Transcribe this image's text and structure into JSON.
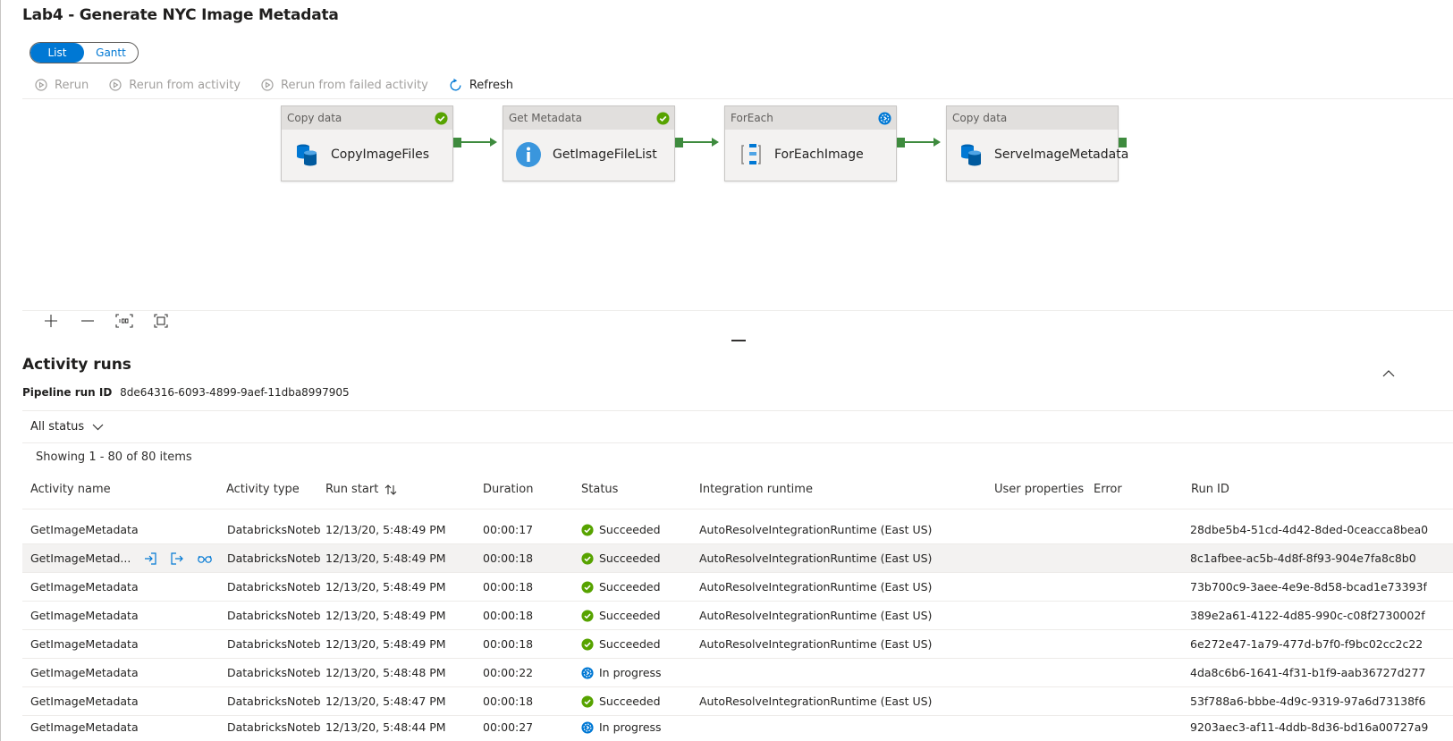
{
  "title": "Lab4 - Generate NYC Image Metadata",
  "view_toggle": {
    "list": "List",
    "gantt": "Gantt"
  },
  "toolbar": {
    "rerun": "Rerun",
    "rerun_from_activity": "Rerun from activity",
    "rerun_from_failed": "Rerun from failed activity",
    "refresh": "Refresh"
  },
  "pipeline": {
    "nodes": [
      {
        "type": "Copy data",
        "name": "CopyImageFiles",
        "icon": "copy-data-icon",
        "status": "succeeded"
      },
      {
        "type": "Get Metadata",
        "name": "GetImageFileList",
        "icon": "info-icon",
        "status": "succeeded"
      },
      {
        "type": "ForEach",
        "name": "ForEachImage",
        "icon": "foreach-icon",
        "status": "in-progress"
      },
      {
        "type": "Copy data",
        "name": "ServeImageMetadata",
        "icon": "copy-data-icon",
        "status": "none"
      }
    ]
  },
  "activity_runs": {
    "title": "Activity runs",
    "pipeline_run_label": "Pipeline run ID",
    "pipeline_run_id": "8de64316-6093-4899-9aef-11dba8997905",
    "filter": "All status",
    "showing": "Showing 1 - 80 of 80 items",
    "columns": {
      "activity_name": "Activity name",
      "activity_type": "Activity type",
      "run_start": "Run start",
      "duration": "Duration",
      "status": "Status",
      "integration_runtime": "Integration runtime",
      "user_properties": "User properties",
      "error": "Error",
      "run_id": "Run ID"
    },
    "rows": [
      {
        "name": "GetImageMetadata",
        "type": "DatabricksNotebook",
        "start": "12/13/20, 5:48:49 PM",
        "duration": "00:00:17",
        "status": "Succeeded",
        "runtime": "AutoResolveIntegrationRuntime (East US)",
        "run_id": "28dbe5b4-51cd-4d42-8ded-0ceacca8bea0"
      },
      {
        "name": "GetImageMetad...",
        "type": "DatabricksNotebook",
        "start": "12/13/20, 5:48:49 PM",
        "duration": "00:00:18",
        "status": "Succeeded",
        "runtime": "AutoResolveIntegrationRuntime (East US)",
        "run_id": "8c1afbee-ac5b-4d8f-8f93-904e7fa8c8b0"
      },
      {
        "name": "GetImageMetadata",
        "type": "DatabricksNotebook",
        "start": "12/13/20, 5:48:49 PM",
        "duration": "00:00:18",
        "status": "Succeeded",
        "runtime": "AutoResolveIntegrationRuntime (East US)",
        "run_id": "73b700c9-3aee-4e9e-8d58-bcad1e73393f"
      },
      {
        "name": "GetImageMetadata",
        "type": "DatabricksNotebook",
        "start": "12/13/20, 5:48:49 PM",
        "duration": "00:00:18",
        "status": "Succeeded",
        "runtime": "AutoResolveIntegrationRuntime (East US)",
        "run_id": "389e2a61-4122-4d85-990c-c08f2730002f"
      },
      {
        "name": "GetImageMetadata",
        "type": "DatabricksNotebook",
        "start": "12/13/20, 5:48:49 PM",
        "duration": "00:00:18",
        "status": "Succeeded",
        "runtime": "AutoResolveIntegrationRuntime (East US)",
        "run_id": "6e272e47-1a79-477d-b7f0-f9bc02cc2c22"
      },
      {
        "name": "GetImageMetadata",
        "type": "DatabricksNotebook",
        "start": "12/13/20, 5:48:48 PM",
        "duration": "00:00:22",
        "status": "In progress",
        "runtime": "",
        "run_id": "4da8c6b6-1641-4f31-b1f9-aab36727d277"
      },
      {
        "name": "GetImageMetadata",
        "type": "DatabricksNotebook",
        "start": "12/13/20, 5:48:47 PM",
        "duration": "00:00:18",
        "status": "Succeeded",
        "runtime": "AutoResolveIntegrationRuntime (East US)",
        "run_id": "53f788a6-bbbe-4d9c-9319-97a6d73138f6"
      },
      {
        "name": "GetImageMetadata",
        "type": "DatabricksNotebook",
        "start": "12/13/20, 5:48:44 PM",
        "duration": "00:00:27",
        "status": "In progress",
        "runtime": "",
        "run_id": "9203aec3-af11-4ddb-8d36-bd16a00727a9"
      }
    ]
  },
  "colors": {
    "accent": "#0078d4",
    "success": "#57a300",
    "connector": "#3e8b3e"
  }
}
